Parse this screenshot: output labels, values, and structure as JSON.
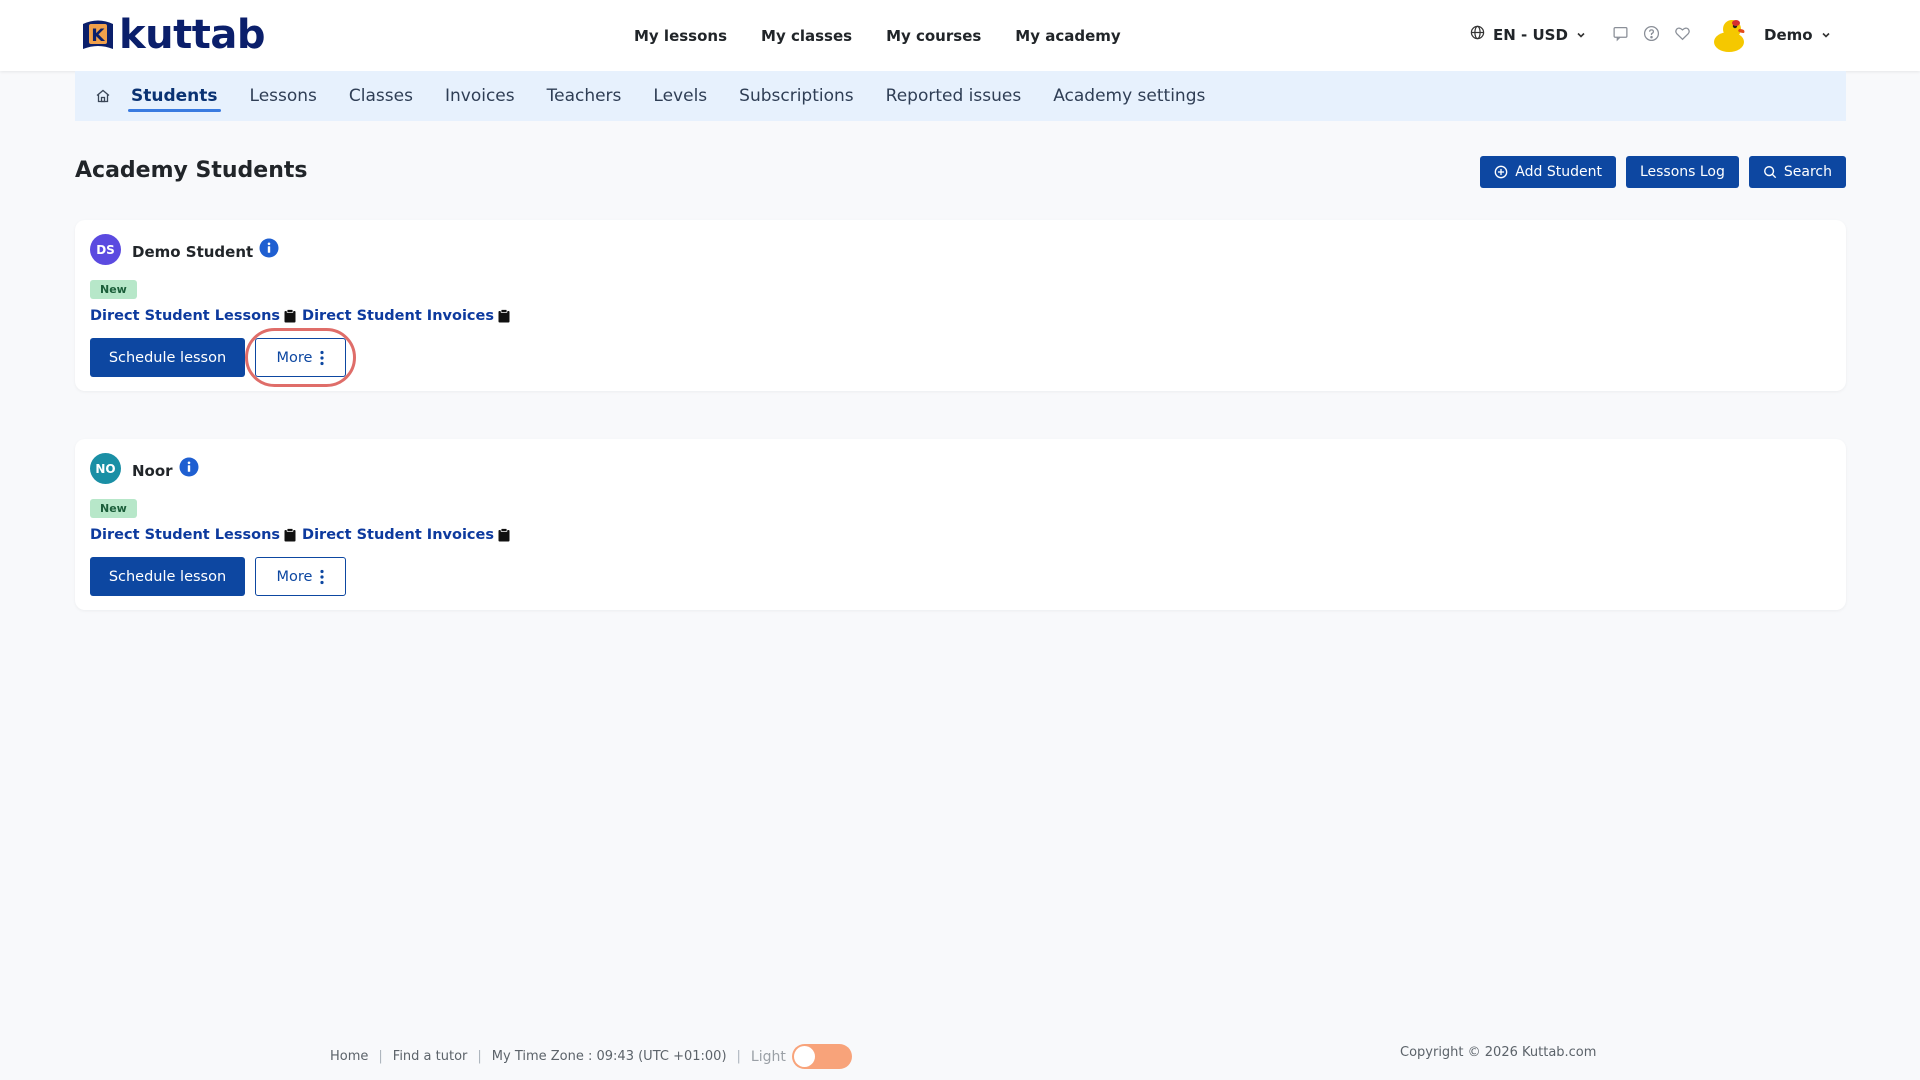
{
  "brand": {
    "logo_letter": "K",
    "logo_text": "kuttab"
  },
  "topnav": [
    "My lessons",
    "My classes",
    "My courses",
    "My academy"
  ],
  "locale": {
    "label": "EN - USD"
  },
  "user": {
    "name": "Demo"
  },
  "subnav": {
    "items": [
      {
        "label": "Students",
        "active": true
      },
      {
        "label": "Lessons"
      },
      {
        "label": "Classes"
      },
      {
        "label": "Invoices"
      },
      {
        "label": "Teachers"
      },
      {
        "label": "Levels"
      },
      {
        "label": "Subscriptions"
      },
      {
        "label": "Reported issues"
      },
      {
        "label": "Academy settings"
      }
    ]
  },
  "page": {
    "title": "Academy Students",
    "add_student": "Add Student",
    "lessons_log": "Lessons Log",
    "search": "Search"
  },
  "students": [
    {
      "initials": "DS",
      "avatar_color": "#5b4ae0",
      "name": "Demo Student",
      "badge": "New",
      "lessons_link": "Direct Student Lessons",
      "invoices_link": "Direct Student Invoices",
      "schedule": "Schedule lesson",
      "more": "More"
    },
    {
      "initials": "NO",
      "avatar_color": "#1a8fa5",
      "name": "Noor",
      "badge": "New",
      "lessons_link": "Direct Student Lessons",
      "invoices_link": "Direct Student Invoices",
      "schedule": "Schedule lesson",
      "more": "More"
    }
  ],
  "footer": {
    "home": "Home",
    "find_tutor": "Find a tutor",
    "timezone": "My Time Zone : 09:43 (UTC +01:00)",
    "theme": "Light",
    "copyright": "Copyright © 2026 Kuttab.com"
  },
  "colors": {
    "primary": "#0d47a1",
    "subnav_bg": "#e7f1fd",
    "toggle": "#f8a37a",
    "highlight": "#d9534f"
  }
}
